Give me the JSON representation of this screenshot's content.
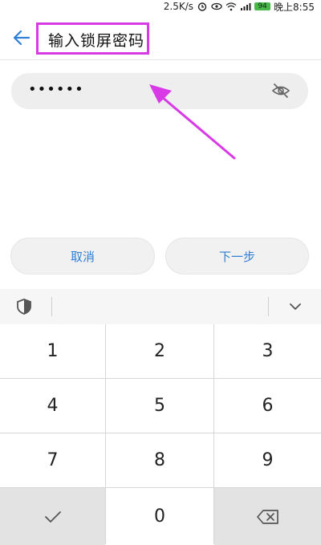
{
  "status_bar": {
    "speed": "2.5K/s",
    "battery": "94",
    "time": "晚上8:55",
    "icons": [
      "alarm-icon",
      "eye-icon",
      "wifi-icon",
      "signal-icon",
      "battery-icon"
    ]
  },
  "header": {
    "title": "输入锁屏密码",
    "back_icon": "back-arrow-icon"
  },
  "password": {
    "value": "••••••",
    "toggle_icon": "eye-off-icon"
  },
  "buttons": {
    "cancel": "取消",
    "next": "下一步"
  },
  "keyboard": {
    "toolbar_icons": [
      "shield-icon",
      "chevron-down-icon"
    ],
    "keys": [
      {
        "label": "1"
      },
      {
        "label": "2"
      },
      {
        "label": "3"
      },
      {
        "label": "4"
      },
      {
        "label": "5"
      },
      {
        "label": "6"
      },
      {
        "label": "7"
      },
      {
        "label": "8"
      },
      {
        "label": "9"
      },
      {
        "label": "",
        "icon": "check-icon"
      },
      {
        "label": "0"
      },
      {
        "label": "",
        "icon": "backspace-icon"
      }
    ]
  },
  "annotations": {
    "highlight_color": "#d83be6"
  },
  "colors": {
    "accent": "#2f7fd6",
    "highlight": "#d83be6"
  }
}
